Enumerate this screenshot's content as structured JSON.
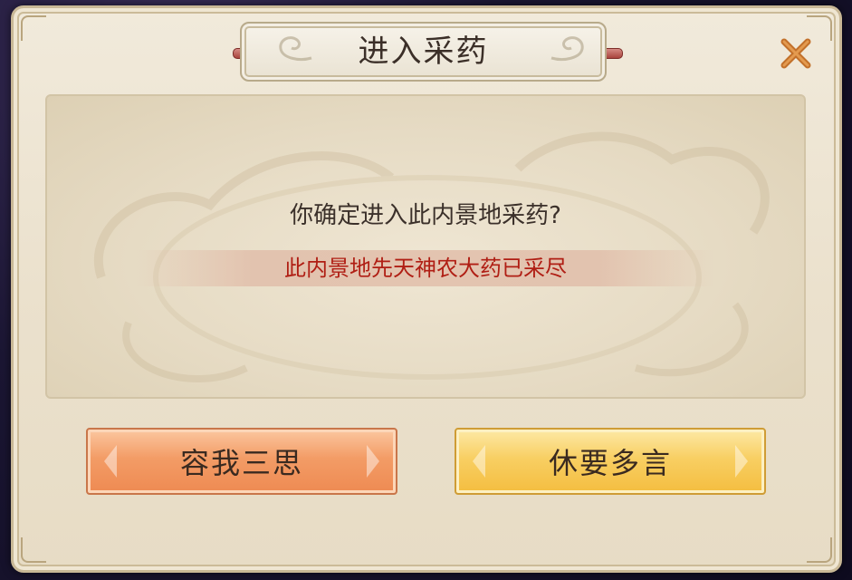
{
  "dialog": {
    "title": "进入采药",
    "question": "你确定进入此内景地采药?",
    "warning": "此内景地先天神农大药已采尽",
    "close_icon": "close-x-icon"
  },
  "buttons": {
    "cancel_label": "容我三思",
    "confirm_label": "休要多言"
  },
  "colors": {
    "warning_text": "#b01e14",
    "cancel_button": "#f39c66",
    "confirm_button": "#f8cf63",
    "close_icon": "#c2702a"
  }
}
